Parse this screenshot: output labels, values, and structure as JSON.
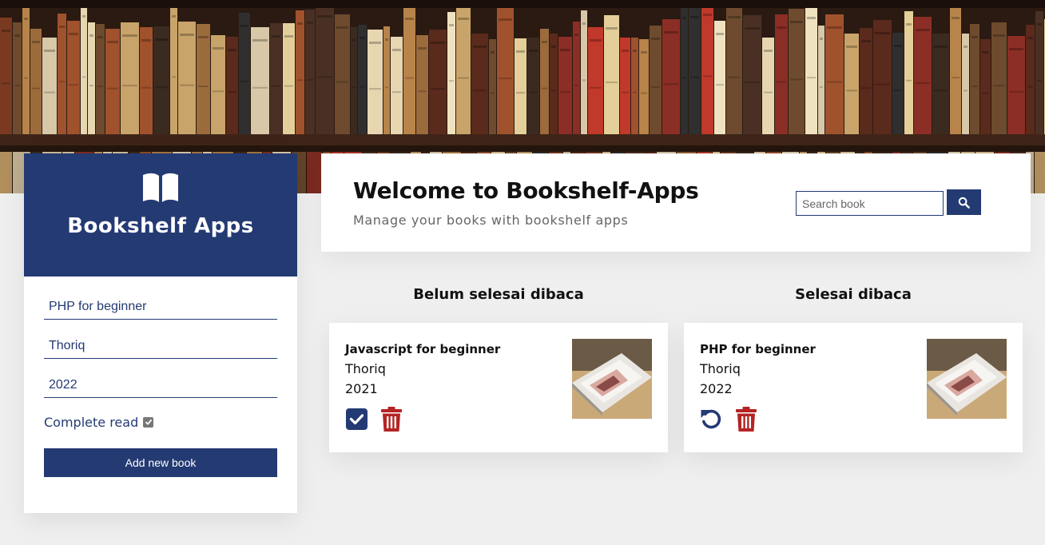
{
  "sidebar": {
    "title": "Bookshelf Apps",
    "form": {
      "title_value": "PHP for beginner",
      "author_value": "Thoriq",
      "year_value": "2022",
      "complete_label": "Complete read",
      "complete_checked": true,
      "submit_label": "Add new book"
    }
  },
  "header": {
    "title": "Welcome to Bookshelf-Apps",
    "subtitle": "Manage your books with bookshelf apps",
    "search_placeholder": "Search book"
  },
  "shelves": [
    {
      "title": "Belum selesai dibaca",
      "books": [
        {
          "title": "Javascript for beginner",
          "author": "Thoriq",
          "year": "2021",
          "primary_action": "check-icon"
        }
      ]
    },
    {
      "title": "Selesai dibaca",
      "books": [
        {
          "title": "PHP for beginner",
          "author": "Thoriq",
          "year": "2022",
          "primary_action": "undo-icon"
        }
      ]
    }
  ],
  "colors": {
    "brand": "#243a73",
    "danger": "#b42424",
    "background": "#efefef"
  }
}
